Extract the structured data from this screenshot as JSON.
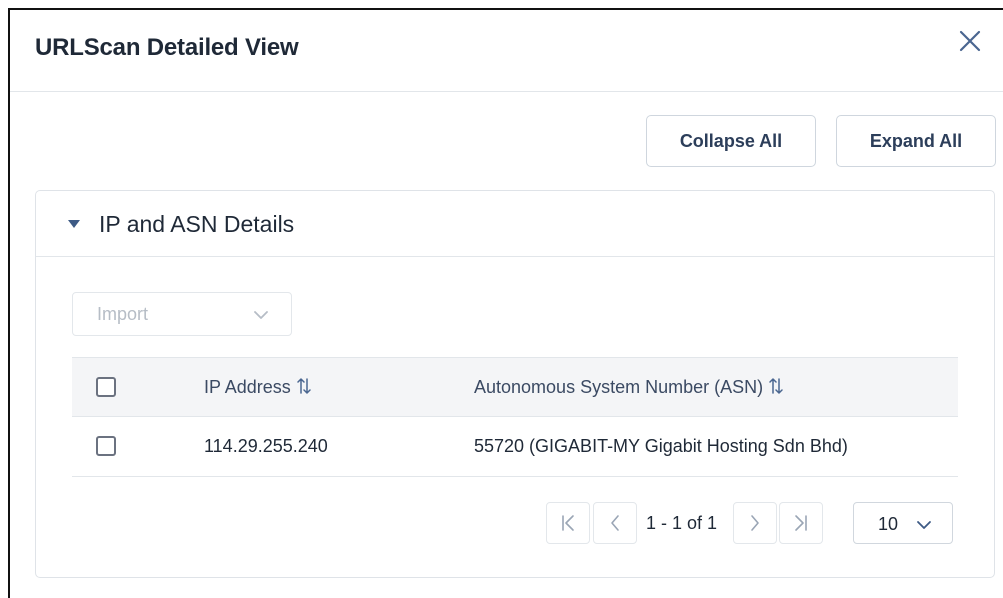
{
  "modal": {
    "title": "URLScan Detailed View"
  },
  "actions": {
    "collapse_all": "Collapse All",
    "expand_all": "Expand All"
  },
  "section": {
    "title": "IP and ASN Details",
    "expanded": true
  },
  "import_select": {
    "label": "Import",
    "disabled": true
  },
  "table": {
    "columns": [
      {
        "label": "IP Address"
      },
      {
        "label": "Autonomous System Number (ASN)"
      }
    ],
    "rows": [
      {
        "ip": "114.29.255.240",
        "asn": "55720 (GIGABIT-MY Gigabit Hosting Sdn Bhd)",
        "checked": false
      }
    ]
  },
  "pagination": {
    "range_text": "1 - 1 of 1",
    "page_size": "10"
  },
  "colors": {
    "accent": "#3d5a85",
    "border": "#e2e6ea",
    "header_bg": "#f4f5f7"
  },
  "icons": [
    "close-icon",
    "caret-down-icon",
    "chevron-down-icon",
    "sort-icon",
    "first-page-icon",
    "prev-page-icon",
    "next-page-icon",
    "last-page-icon"
  ]
}
